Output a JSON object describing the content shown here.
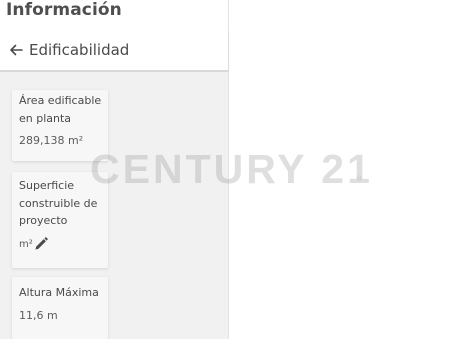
{
  "header": {
    "app_title": "Información",
    "section_title": "Edificabilidad"
  },
  "cards": [
    {
      "label_lines": [
        "Área edificable",
        "en planta"
      ],
      "value": "289,138 m²"
    },
    {
      "label_lines": [
        "Superficie",
        "construible de",
        "proyecto"
      ],
      "value": "m²",
      "icon": "pencil-icon"
    },
    {
      "label_lines": [
        "Altura Máxima"
      ],
      "value": "11,6 m"
    }
  ],
  "watermark": {
    "text": "CENTURY 21",
    "mark": "®"
  },
  "colors": {
    "panel_bg": "#ffffff",
    "content_bg": "#f1f1f1",
    "card_bg": "#f7f7f7",
    "text": "#4a4a4a"
  }
}
